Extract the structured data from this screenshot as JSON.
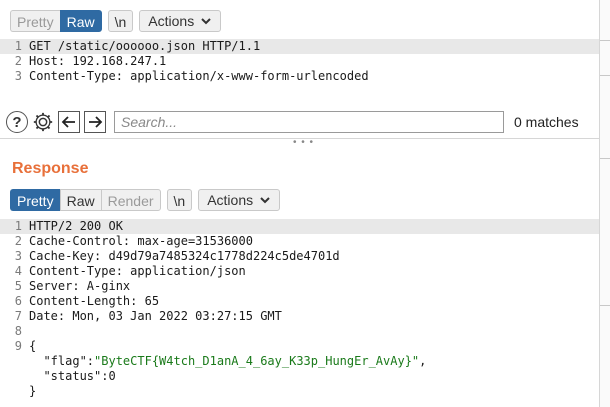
{
  "request": {
    "toolbar": {
      "pretty": "Pretty",
      "raw": "Raw",
      "newline": "\\n",
      "actions": "Actions"
    },
    "lines": [
      {
        "num": "1",
        "text": "GET /static/oooooo.json HTTP/1.1"
      },
      {
        "num": "2",
        "text": "Host: 192.168.247.1"
      },
      {
        "num": "3",
        "text": "Content-Type: application/x-www-form-urlencoded"
      }
    ]
  },
  "search": {
    "placeholder": "Search...",
    "matches": "0 matches"
  },
  "icons": {
    "help": "help-icon",
    "settings": "gear-icon",
    "back": "arrow-left-icon",
    "forward": "arrow-right-icon",
    "dropdown": "chevron-down-icon",
    "resize": "grip-icon"
  },
  "response": {
    "title": "Response",
    "toolbar": {
      "pretty": "Pretty",
      "raw": "Raw",
      "render": "Render",
      "newline": "\\n",
      "actions": "Actions"
    },
    "lines": [
      {
        "num": "1",
        "text": "HTTP/2 200 OK"
      },
      {
        "num": "2",
        "text": "Cache-Control: max-age=31536000"
      },
      {
        "num": "3",
        "text": "Cache-Key: d49d79a7485324c1778d224c5de4701d"
      },
      {
        "num": "4",
        "text": "Content-Type: application/json"
      },
      {
        "num": "5",
        "text": "Server: A-ginx"
      },
      {
        "num": "6",
        "text": "Content-Length: 65"
      },
      {
        "num": "7",
        "text": "Date: Mon, 03 Jan 2022 03:27:15 GMT"
      },
      {
        "num": "8",
        "text": ""
      },
      {
        "num": "9",
        "text": "{"
      },
      {
        "num": "",
        "key": "  \"flag\":",
        "value": "\"ByteCTF{W4tch_D1anA_4_6ay_K33p_HungEr_AvAy}\"",
        "tail": ","
      },
      {
        "num": "",
        "key": "  \"status\":",
        "value": "0",
        "tail": ""
      },
      {
        "num": "",
        "text": "}"
      }
    ]
  },
  "colors": {
    "accent": "#2f6aa3",
    "response_title": "#e8703a",
    "json_string": "#1a7a1a"
  }
}
